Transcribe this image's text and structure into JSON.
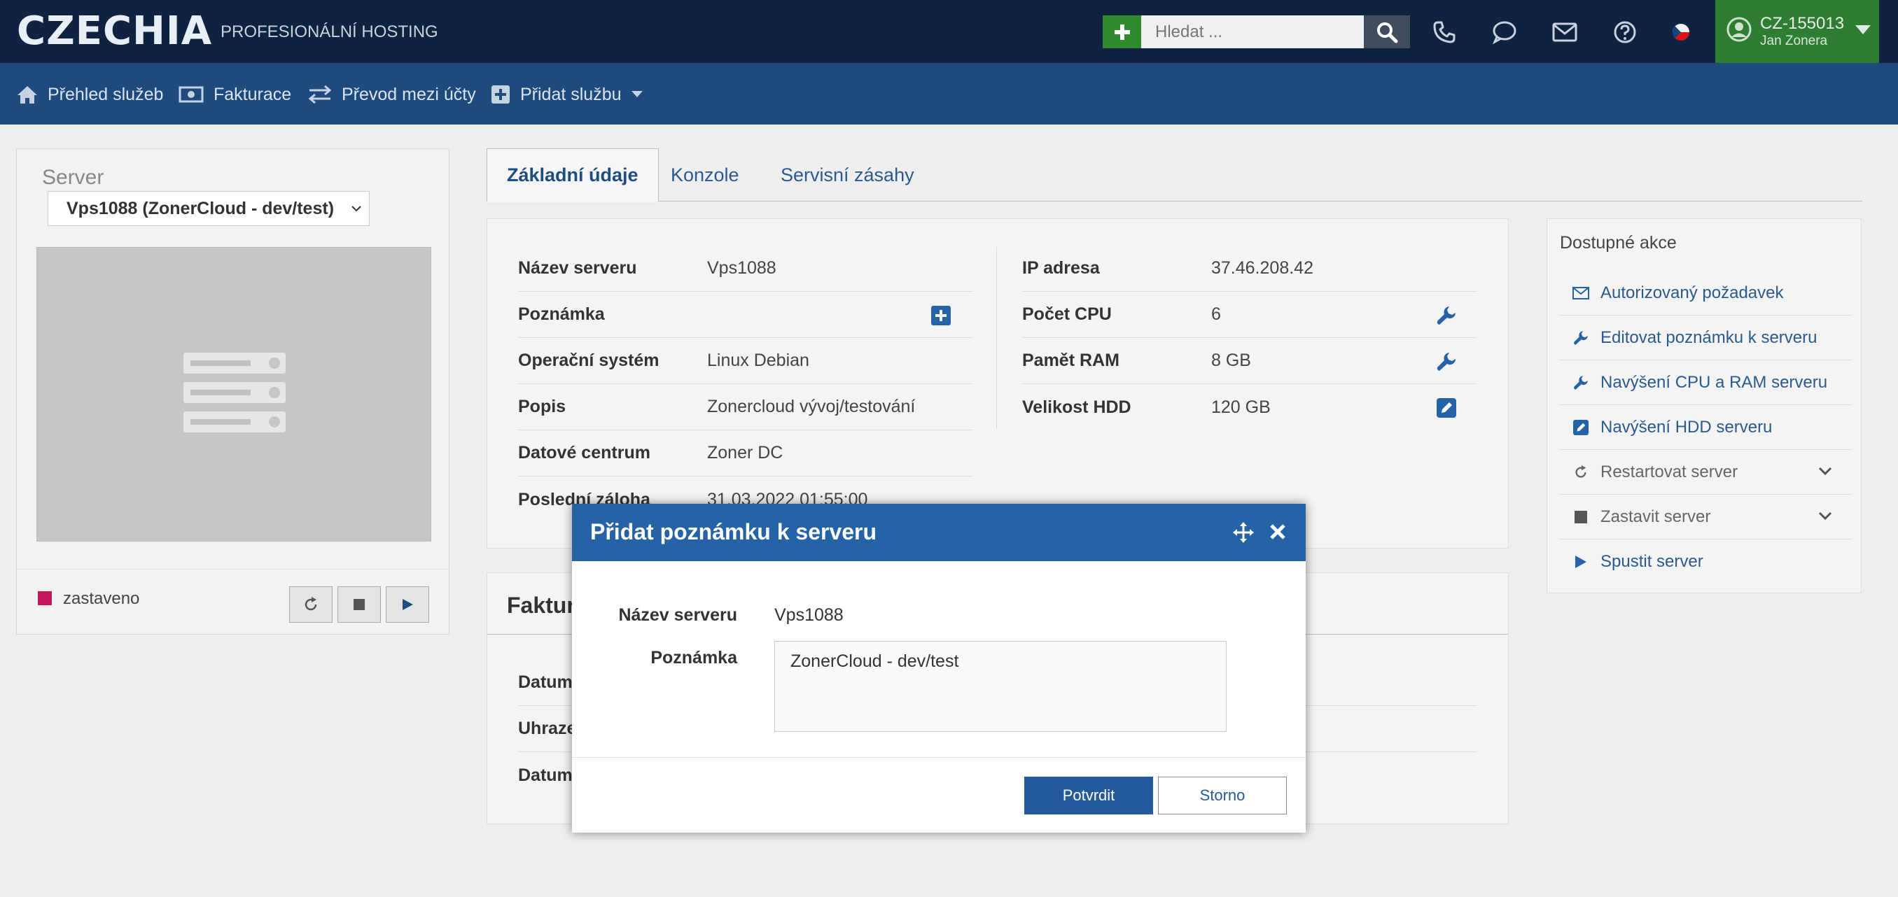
{
  "header": {
    "logo": "CZECHIA",
    "subtitle": "PROFESIONÁLNÍ HOSTING",
    "search_placeholder": "Hledat ...",
    "user_id": "CZ-155013",
    "user_name": "Jan Zonera"
  },
  "nav": {
    "items": [
      {
        "label": "Přehled služeb",
        "icon": "home-icon"
      },
      {
        "label": "Fakturace",
        "icon": "money-icon"
      },
      {
        "label": "Převod mezi účty",
        "icon": "transfer-icon"
      },
      {
        "label": "Přidat službu",
        "icon": "plus-square-icon"
      }
    ]
  },
  "left_panel": {
    "server_label": "Server",
    "selected_server": "Vps1088 (ZonerCloud - dev/test)",
    "status": "zastaveno",
    "status_color": "#c2185b"
  },
  "tabs": [
    {
      "label": "Základní údaje",
      "active": true
    },
    {
      "label": "Konzole",
      "active": false
    },
    {
      "label": "Servisní zásahy",
      "active": false
    }
  ],
  "info": {
    "left": [
      {
        "key": "Název serveru",
        "value": "Vps1088"
      },
      {
        "key": "Poznámka",
        "value": ""
      },
      {
        "key": "Operační systém",
        "value": "Linux Debian"
      },
      {
        "key": "Popis",
        "value": "Zonercloud vývoj/testování"
      },
      {
        "key": "Datové centrum",
        "value": "Zoner DC"
      },
      {
        "key": "Poslední záloha",
        "value": "31.03.2022 01:55:00"
      }
    ],
    "right": [
      {
        "key": "IP adresa",
        "value": "37.46.208.42"
      },
      {
        "key": "Počet CPU",
        "value": "6"
      },
      {
        "key": "Pamět RAM",
        "value": "8 GB"
      },
      {
        "key": "Velikost HDD",
        "value": "120 GB"
      }
    ]
  },
  "invoice": {
    "title": "Faktura",
    "rows": [
      "Datum",
      "Uhraze",
      "Datum"
    ]
  },
  "actions": {
    "title": "Dostupné akce",
    "items": [
      {
        "label": "Autorizovaný požadavek",
        "icon": "envelope-icon"
      },
      {
        "label": "Editovat poznámku k serveru",
        "icon": "wrench-icon"
      },
      {
        "label": "Navýšení CPU a RAM serveru",
        "icon": "wrench-icon"
      },
      {
        "label": "Navýšení HDD serveru",
        "icon": "edit-icon"
      },
      {
        "label": "Restartovat server",
        "icon": "refresh-icon"
      },
      {
        "label": "Zastavit server",
        "icon": "stop-icon"
      },
      {
        "label": "Spustit server",
        "icon": "play-icon"
      }
    ]
  },
  "modal": {
    "title": "Přidat poznámku k serveru",
    "name_label": "Název serveru",
    "name_value": "Vps1088",
    "note_label": "Poznámka",
    "note_value": "ZonerCloud - dev/test",
    "confirm_label": "Potvrdit",
    "cancel_label": "Storno"
  }
}
